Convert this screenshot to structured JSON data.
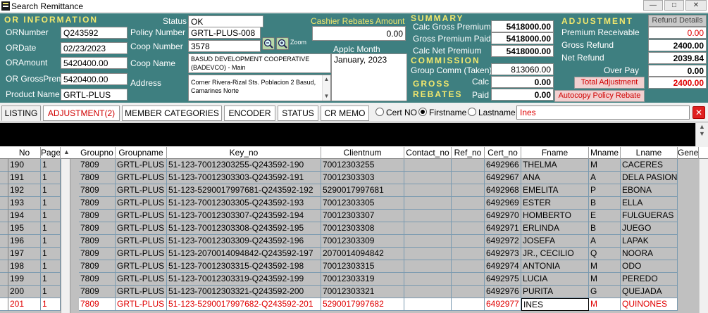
{
  "window": {
    "title": "Search Remittance",
    "controls": [
      "—",
      "□",
      "✕"
    ]
  },
  "or_info": {
    "section_title": "OR INFORMATION",
    "ornumber_label": "ORNumber",
    "ornumber": "Q243592",
    "ordate_label": "ORDate",
    "ordate": "02/23/2023",
    "oramount_label": "ORAmount",
    "oramount": "5420400.00",
    "orgross_label": "OR GrossPrem",
    "orgross": "5420400.00",
    "product_label": "Product Name",
    "product": "GRTL-PLUS"
  },
  "policy": {
    "status_label": "Status",
    "status": "OK",
    "policy_label": "Policy Number",
    "policy": "GRTL-PLUS-008",
    "coop_number_label": "Coop Number",
    "coop_number": "3578",
    "zoom_label": "Zoom",
    "coop_name_label": "Coop Name",
    "coop_name": "BASUD DEVELOPMENT COOPERATIVE (BADEVCO) - Main",
    "address_label": "Address",
    "address": "Corner Rivera-Rizal Sts. Poblacion 2 Basud, Camarines Norte"
  },
  "cashier": {
    "rebates_label": "Cashier Rebates Amount",
    "rebates": "0.00",
    "applc_month_label": "Applc Month",
    "applc_month": "January, 2023"
  },
  "summary": {
    "section_title": "SUMMARY",
    "calc_gross_label": "Calc Gross Premium",
    "calc_gross": "5418000.00",
    "gross_paid_label": "Gross Premium Paid",
    "gross_paid": "5418000.00",
    "calc_net_label": "Calc Net Premium",
    "calc_net": "5418000.00",
    "commission_title": "COMMISSION",
    "group_comm_label": "Group Comm (Taken)",
    "group_comm": "813060.00",
    "gross_rebates_title_1": "GROSS",
    "gross_rebates_title_2": "REBATES",
    "calc_label": "Calc",
    "calc": "0.00",
    "paid_label": "Paid",
    "paid": "0.00"
  },
  "adjustment": {
    "section_title": "ADJUSTMENT",
    "refund_details_button": "Refund Details",
    "premium_receivable_label": "Premium Receivable",
    "premium_receivable": "0.00",
    "gross_refund_label": "Gross Refund",
    "gross_refund": "2400.00",
    "net_refund_label": "Net Refund",
    "net_refund": "2039.84",
    "over_pay_label": "Over Pay",
    "over_pay": "0.00",
    "total_adjustment_label": "Total Adjustment",
    "total_adjustment": "2400.00",
    "autocopy_button": "Autocopy Policy Rebate"
  },
  "tabs": [
    {
      "label": "LISTING"
    },
    {
      "label": "ADJUSTMENT(2)"
    },
    {
      "label": "MEMBER CATEGORIES"
    },
    {
      "label": "ENCODER"
    },
    {
      "label": "STATUS"
    },
    {
      "label": "CR MEMO"
    }
  ],
  "search": {
    "options": [
      "Cert NO",
      "Firstname",
      "Lastname"
    ],
    "selected": "Firstname",
    "value": "Ines"
  },
  "grid": {
    "columns": [
      "No",
      "Page",
      "Groupno",
      "Groupname",
      "Key_no",
      "Clientnum",
      "Contact_no",
      "Ref_no",
      "Cert_no",
      "Fname",
      "Mname",
      "Lname",
      "Gene"
    ],
    "rows": [
      [
        "190",
        "1",
        "7809",
        "GRTL-PLUS",
        "51-123-70012303255-Q243592-190",
        "70012303255",
        "",
        "",
        "6492966",
        "THELMA",
        "M",
        "CACERES"
      ],
      [
        "191",
        "1",
        "7809",
        "GRTL-PLUS",
        "51-123-70012303303-Q243592-191",
        "70012303303",
        "",
        "",
        "6492967",
        "ANA",
        "A",
        "DELA PASION"
      ],
      [
        "192",
        "1",
        "7809",
        "GRTL-PLUS",
        "51-123-5290017997681-Q243592-192",
        "5290017997681",
        "",
        "",
        "6492968",
        "EMELITA",
        "P",
        "EBONA"
      ],
      [
        "193",
        "1",
        "7809",
        "GRTL-PLUS",
        "51-123-70012303305-Q243592-193",
        "70012303305",
        "",
        "",
        "6492969",
        "ESTER",
        "B",
        "ELLA"
      ],
      [
        "194",
        "1",
        "7809",
        "GRTL-PLUS",
        "51-123-70012303307-Q243592-194",
        "70012303307",
        "",
        "",
        "6492970",
        "HOMBERTO",
        "E",
        "FULGUERAS"
      ],
      [
        "195",
        "1",
        "7809",
        "GRTL-PLUS",
        "51-123-70012303308-Q243592-195",
        "70012303308",
        "",
        "",
        "6492971",
        "ERLINDA",
        "B",
        "JUEGO"
      ],
      [
        "196",
        "1",
        "7809",
        "GRTL-PLUS",
        "51-123-70012303309-Q243592-196",
        "70012303309",
        "",
        "",
        "6492972",
        "JOSEFA",
        "A",
        "LAPAK"
      ],
      [
        "197",
        "1",
        "7809",
        "GRTL-PLUS",
        "51-123-2070014094842-Q243592-197",
        "2070014094842",
        "",
        "",
        "6492973",
        "JR., CECILIO",
        "Q",
        "NOORA"
      ],
      [
        "198",
        "1",
        "7809",
        "GRTL-PLUS",
        "51-123-70012303315-Q243592-198",
        "70012303315",
        "",
        "",
        "6492974",
        "ANTONIA",
        "M",
        "ODO"
      ],
      [
        "199",
        "1",
        "7809",
        "GRTL-PLUS",
        "51-123-70012303319-Q243592-199",
        "70012303319",
        "",
        "",
        "6492975",
        "LUCIA",
        "M",
        "PEREDO"
      ],
      [
        "200",
        "1",
        "7809",
        "GRTL-PLUS",
        "51-123-70012303321-Q243592-200",
        "70012303321",
        "",
        "",
        "6492976",
        "PURITA",
        "G",
        "QUEJADA"
      ],
      [
        "201",
        "1",
        "7809",
        "GRTL-PLUS",
        "51-123-5290017997682-Q243592-201",
        "5290017997682",
        "",
        "",
        "6492977",
        "INES",
        "M",
        "QUINONES"
      ]
    ],
    "selected_row": 11
  },
  "colors": {
    "header_bg": "#3e7f80",
    "accent_yellow": "#f2e86d",
    "red": "#e00000"
  }
}
